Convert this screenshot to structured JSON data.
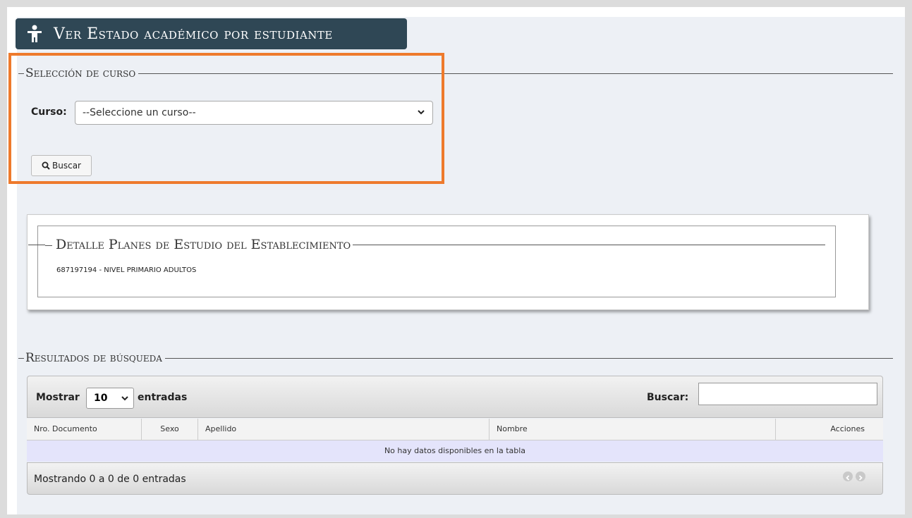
{
  "header": {
    "title": "Ver Estado académico por estudiante",
    "icon": "person-icon"
  },
  "seleccion": {
    "legend": "Selección de curso",
    "curso_label": "Curso:",
    "curso_selected": "--Seleccione un curso--",
    "buscar_button": "Buscar"
  },
  "detalle": {
    "legend": "Detalle Planes de Estudio del Establecimiento",
    "plan": "687197194 - NIVEL PRIMARIO ADULTOS"
  },
  "resultados": {
    "legend": "Resultados de búsqueda",
    "mostrar_label": "Mostrar",
    "page_length": "10",
    "entradas_label": "entradas",
    "buscar_label": "Buscar:",
    "columns": [
      "Nro. Documento",
      "Sexo",
      "Apellido",
      "Nombre",
      "Acciones"
    ],
    "empty_message": "No hay datos disponibles en la tabla",
    "info": "Mostrando 0 a 0 de 0 entradas"
  },
  "colors": {
    "header_bg": "#2f4755",
    "highlight": "#ee7a2c",
    "panel_bg": "#edf0f5"
  }
}
